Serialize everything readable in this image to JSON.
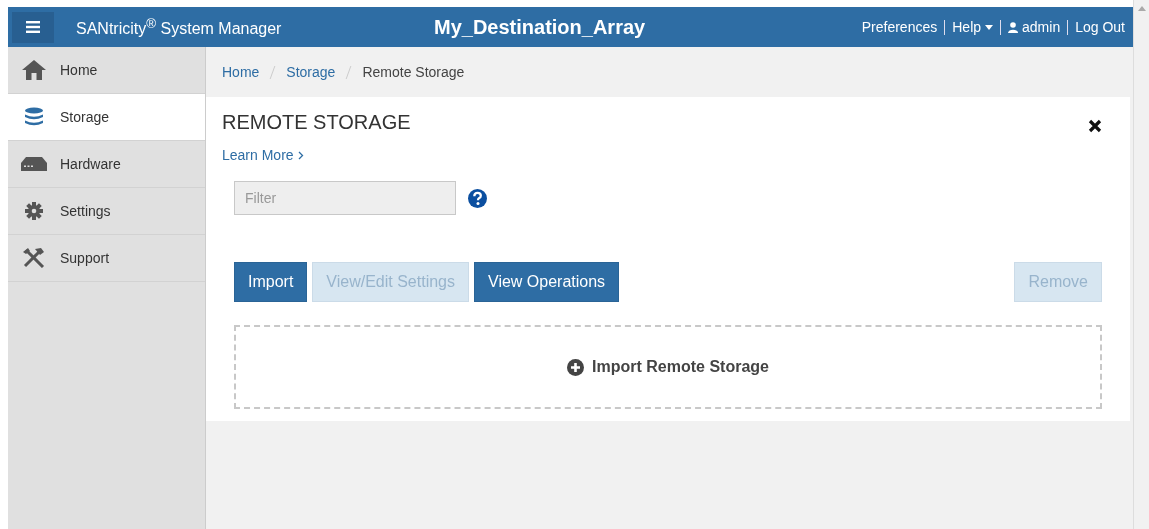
{
  "header": {
    "app_title": "SANtricity$^{®}$ System Manager",
    "array_name": "My_Destination_Array",
    "links": [
      {
        "label": "Preferences",
        "kind": "plain"
      },
      {
        "label": "Help",
        "kind": "dropdown"
      },
      {
        "label": "admin",
        "kind": "user"
      },
      {
        "label": "Log Out",
        "kind": "plain"
      }
    ]
  },
  "sidebar": {
    "items": [
      {
        "label": "Home",
        "selected": false
      },
      {
        "label": "Storage",
        "selected": true
      },
      {
        "label": "Hardware",
        "selected": false
      },
      {
        "label": "Settings",
        "selected": false
      },
      {
        "label": "Support",
        "selected": false
      }
    ]
  },
  "breadcrumb": [
    {
      "label": "Home",
      "link": true
    },
    {
      "label": "Storage",
      "link": true
    },
    {
      "label": "Remote Storage",
      "link": false
    }
  ],
  "panel": {
    "title": "REMOTE STORAGE",
    "learn_more": "Learn More",
    "filter": {
      "placeholder": "Filter"
    },
    "buttons": [
      {
        "label": "Import",
        "disabled": false
      },
      {
        "label": "View/Edit Settings",
        "disabled": true
      },
      {
        "label": "View Operations",
        "disabled": false
      }
    ],
    "remove_button": {
      "label": "Remove",
      "disabled": true
    },
    "import_area": {
      "label": "Import Remote Storage"
    }
  }
}
